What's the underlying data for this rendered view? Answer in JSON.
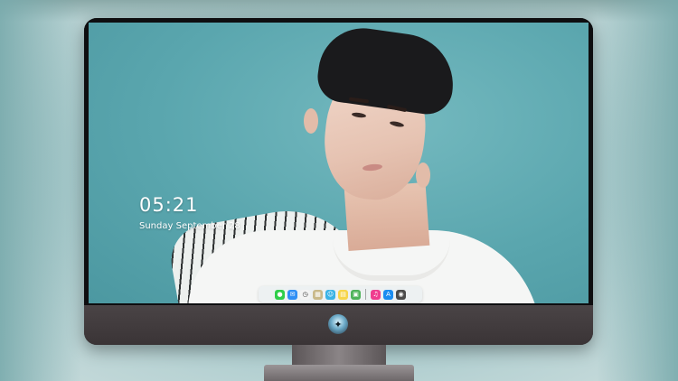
{
  "lock_screen": {
    "time": "05:21",
    "date": "Sunday September  28"
  },
  "dock": {
    "apps": [
      {
        "icon": "messages-icon",
        "color": "#2fce4a",
        "glyph": "●"
      },
      {
        "icon": "mail-icon",
        "color": "#2e8ff5",
        "glyph": "✉"
      },
      {
        "icon": "clock-icon",
        "color": "#f4f4f4",
        "glyph": "◷"
      },
      {
        "icon": "preview-icon",
        "color": "#c8b98a",
        "glyph": "▦"
      },
      {
        "icon": "finder-icon",
        "color": "#3ab3e6",
        "glyph": "☺"
      },
      {
        "icon": "notes-icon",
        "color": "#f7d54a",
        "glyph": "▤"
      },
      {
        "icon": "photos-icon",
        "color": "#4fb35a",
        "glyph": "▣"
      }
    ],
    "apps_right": [
      {
        "icon": "itunes-icon",
        "color": "#ef3d8f",
        "glyph": "♫"
      },
      {
        "icon": "app-store-icon",
        "color": "#1b8df0",
        "glyph": "A"
      },
      {
        "icon": "camera-icon",
        "color": "#4b4b4b",
        "glyph": "◉"
      }
    ]
  }
}
